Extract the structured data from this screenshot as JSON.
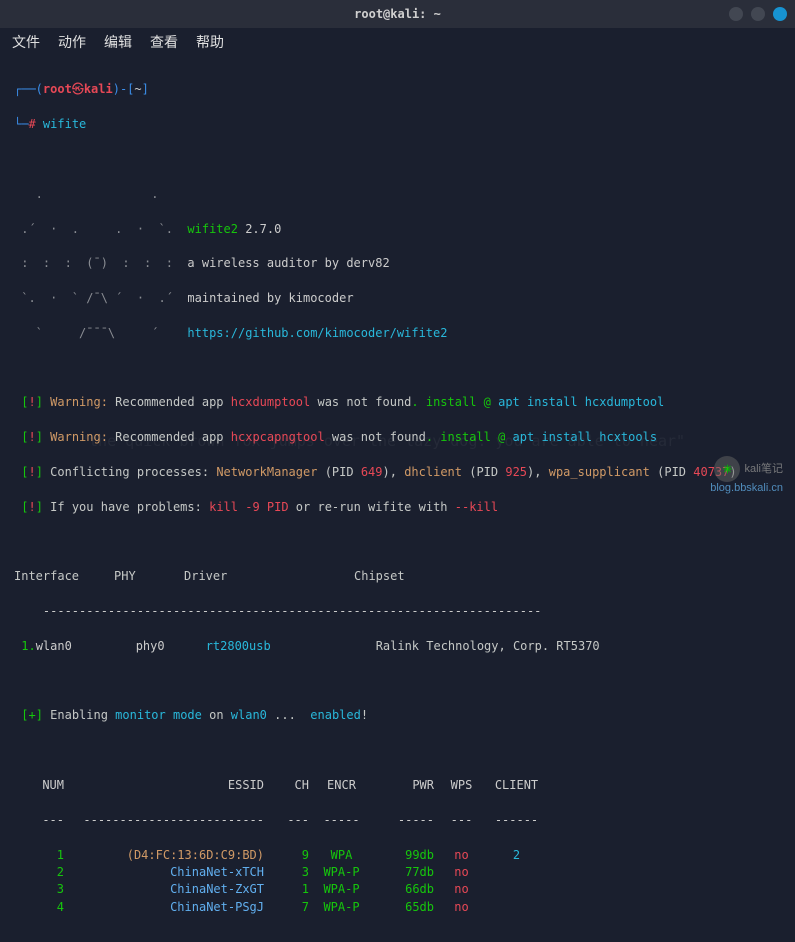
{
  "window": {
    "title": "root@kali: ~"
  },
  "menu": {
    "items": [
      "文件",
      "动作",
      "编辑",
      "查看",
      "帮助"
    ]
  },
  "prompt": {
    "paren_open": "┌──(",
    "user": "root",
    "at": "㉿",
    "host": "kali",
    "paren_close": ")-[",
    "cwd": "~",
    "bracket_close": "]",
    "line2_prefix": "└─",
    "hash": "#",
    "command": "wifite"
  },
  "banner": {
    "art": [
      "   .               .    ",
      " .´  ·  .     .  ·  `.  ",
      " :  :  :  (¯)  :  :  :  ",
      " `.  ·  ` /¯\\ ´  ·  .´  ",
      "   `     /¯¯¯\\     ´    "
    ],
    "name": "wifite2",
    "version": "2.7.0",
    "tagline": "a wireless auditor by derv82",
    "maintainer": "maintained by kimocoder",
    "url": "https://github.com/kimocoder/wifite2"
  },
  "warnings": {
    "w1": {
      "prefix": " [",
      "bang": "!",
      "suffix": "] ",
      "label": "Warning:",
      "text1": " Recommended app ",
      "app": "hcxdumptool",
      "text2": " was not found",
      "inst": ". install @ ",
      "cmd": "apt install hcxdumptool"
    },
    "w2": {
      "prefix": " [",
      "bang": "!",
      "suffix": "] ",
      "label": "Warning:",
      "text1": " Recommended app ",
      "app": "hcxpcapngtool",
      "text2": " was not found",
      "inst": ". install @ ",
      "cmd": "apt install hcxtools"
    },
    "conflict": {
      "prefix": " [",
      "bang": "!",
      "suffix": "] ",
      "label": "Conflicting processes: ",
      "p1": "NetworkManager",
      "pid1_l": " (PID ",
      "pid1": "649",
      "pid1_r": "), ",
      "p2": "dhclient",
      "pid2_l": " (PID ",
      "pid2": "925",
      "pid2_r": "), ",
      "p3": "wpa_supplicant",
      "pid3_l": " (PID ",
      "pid3": "40737",
      "pid3_r": ")"
    },
    "problems": {
      "prefix": " [",
      "bang": "!",
      "suffix": "] ",
      "text1": "If you have problems: ",
      "kill": "kill -9 PID",
      "text2": " or re-run wifite with ",
      "flag": "--kill"
    }
  },
  "iface_table": {
    "headers": {
      "iface": "Interface",
      "phy": "PHY",
      "driver": "Driver",
      "chipset": "Chipset"
    },
    "sep": "    ---------------------------------------------------------------------",
    "row1": {
      "num": " 1.",
      "iface": "wlan0",
      "phy": "phy0",
      "driver": "rt2800usb",
      "chipset": "Ralink Technology, Corp. RT5370"
    }
  },
  "monitor": {
    "prefix": " [",
    "plus": "+",
    "suffix": "] ",
    "text1": "Enabling ",
    "mode": "monitor mode",
    "text2": " on ",
    "iface": "wlan0",
    "dots": "... ",
    "result": "enabled",
    "bang2": "!"
  },
  "net_table": {
    "headers": {
      "num": "NUM",
      "essid": "ESSID",
      "ch": "CH",
      "encr": "ENCR",
      "pwr": "PWR",
      "wps": "WPS",
      "client": "CLIENT"
    },
    "rule": {
      "num": "---",
      "essid": "-------------------------",
      "ch": "---",
      "encr": "-----",
      "pwr": "-----",
      "wps": "---",
      "client": "------"
    },
    "rows": [
      {
        "num": "1",
        "essid": "(D4:FC:13:6D:C9:BD)",
        "essid_color": "orange",
        "ch": "9",
        "encr": "WPA",
        "pwr": "99db",
        "wps": "no",
        "client": "2"
      },
      {
        "num": "2",
        "essid": "ChinaNet-xTCH",
        "essid_color": "lightblue",
        "ch": "3",
        "encr": "WPA-P",
        "pwr": "77db",
        "wps": "no",
        "client": ""
      },
      {
        "num": "3",
        "essid": "ChinaNet-ZxGT",
        "essid_color": "lightblue",
        "ch": "1",
        "encr": "WPA-P",
        "pwr": "66db",
        "wps": "no",
        "client": ""
      },
      {
        "num": "4",
        "essid": "ChinaNet-PSgJ",
        "essid_color": "lightblue",
        "ch": "7",
        "encr": "WPA-P",
        "pwr": "65db",
        "wps": "no",
        "client": ""
      }
    ]
  },
  "watermark": {
    "name": "kali笔记",
    "url": "blog.bbskali.cn"
  },
  "bg_decor": "\"the quick brown fox jumps over the lazy dog. you are able to hear\""
}
